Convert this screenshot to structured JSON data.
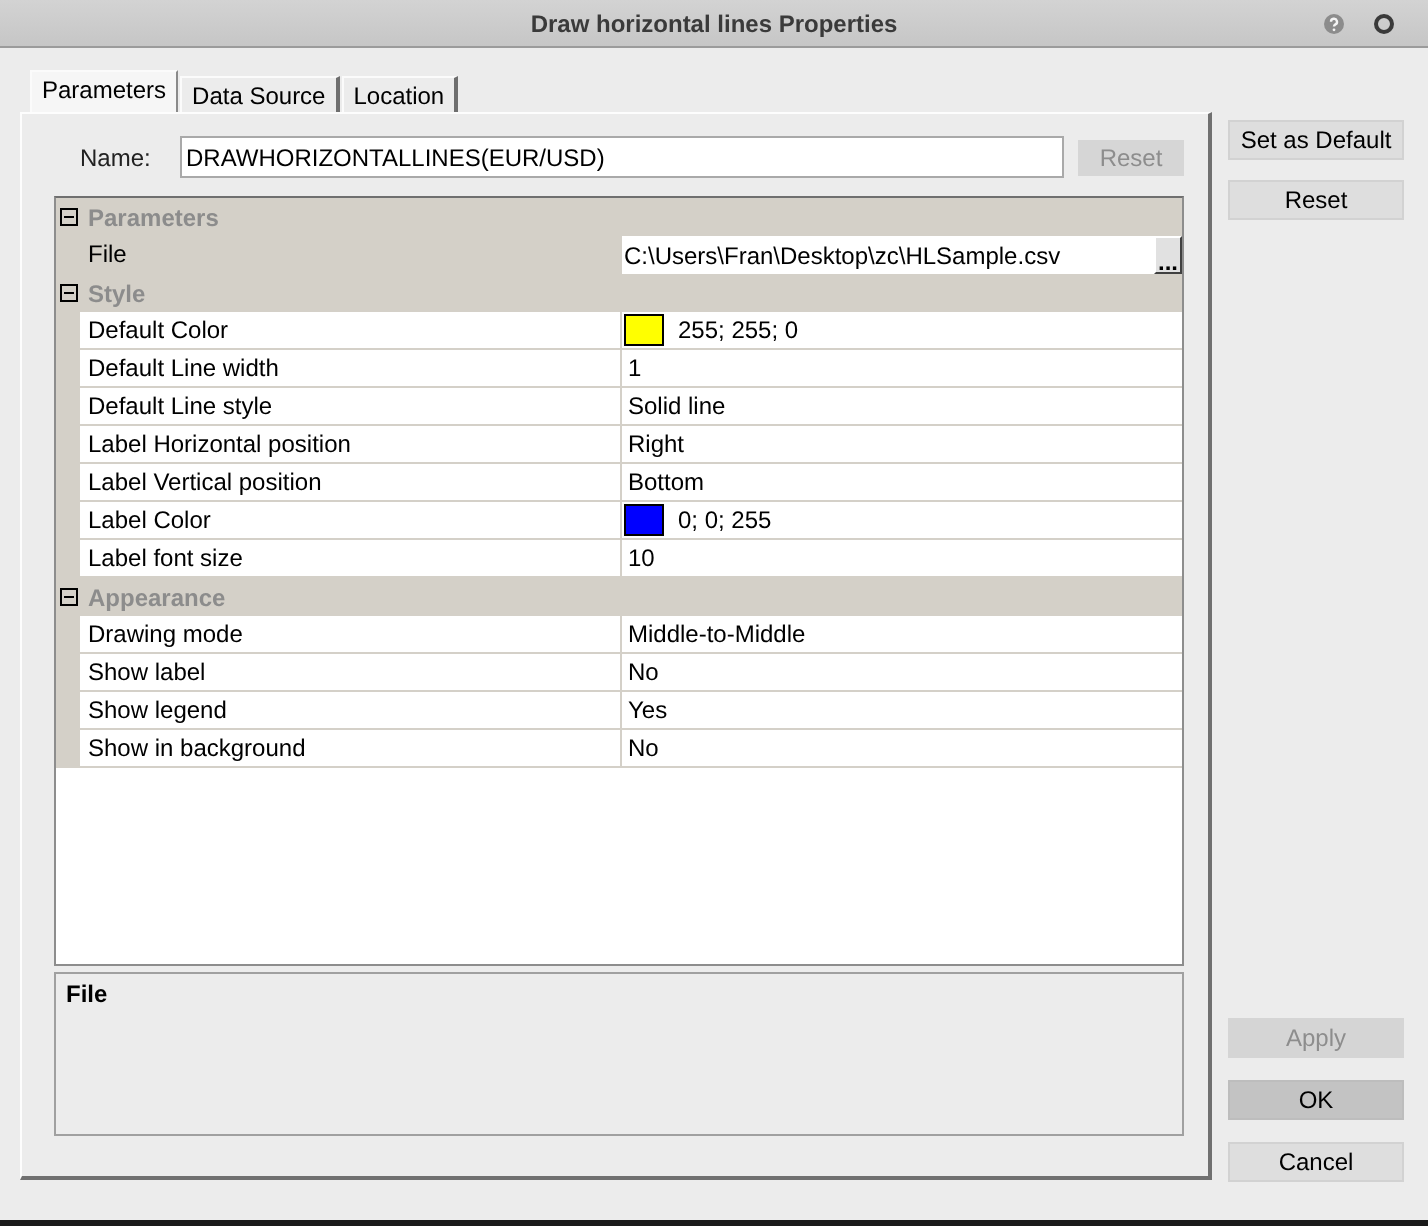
{
  "window": {
    "title": "Draw horizontal lines Properties"
  },
  "tabs": [
    {
      "label": "Parameters",
      "selected": true
    },
    {
      "label": "Data Source",
      "selected": false
    },
    {
      "label": "Location",
      "selected": false
    }
  ],
  "name_field": {
    "label": "Name:",
    "value": "DRAWHORIZONTALLINES(EUR/USD)",
    "reset_button": {
      "label": "Reset",
      "disabled": true
    }
  },
  "property_grid": {
    "categories": [
      {
        "name": "Parameters",
        "expanded": true,
        "properties": [
          {
            "name": "File",
            "kind": "file",
            "value": "C:\\Users\\Fran\\Desktop\\zc\\HLSample.csv",
            "browse_button": "...",
            "selected": true
          }
        ]
      },
      {
        "name": "Style",
        "expanded": true,
        "properties": [
          {
            "name": "Default Color",
            "kind": "color",
            "color": "#ffff00",
            "value": "255; 255; 0",
            "selected": false
          },
          {
            "name": "Default Line width",
            "kind": "text",
            "value": "1",
            "selected": false
          },
          {
            "name": "Default Line style",
            "kind": "text",
            "value": "Solid line",
            "selected": false
          },
          {
            "name": "Label Horizontal position",
            "kind": "text",
            "value": "Right",
            "selected": false
          },
          {
            "name": "Label Vertical position",
            "kind": "text",
            "value": "Bottom",
            "selected": false
          },
          {
            "name": "Label Color",
            "kind": "color",
            "color": "#0000ff",
            "value": "0; 0; 255",
            "selected": false
          },
          {
            "name": "Label font size",
            "kind": "text",
            "value": "10",
            "selected": false
          }
        ]
      },
      {
        "name": "Appearance",
        "expanded": true,
        "properties": [
          {
            "name": "Drawing mode",
            "kind": "text",
            "value": "Middle-to-Middle",
            "selected": false
          },
          {
            "name": "Show label",
            "kind": "text",
            "value": "No",
            "selected": false
          },
          {
            "name": "Show legend",
            "kind": "text",
            "value": "Yes",
            "selected": false
          },
          {
            "name": "Show in background",
            "kind": "text",
            "value": "No",
            "selected": false
          }
        ]
      }
    ]
  },
  "description": {
    "title": "File"
  },
  "side_buttons": [
    {
      "label": "Set as Default",
      "disabled": false
    },
    {
      "label": "Reset",
      "disabled": false
    }
  ],
  "dialog_buttons": [
    {
      "label": "Apply",
      "disabled": true,
      "default": false
    },
    {
      "label": "OK",
      "disabled": false,
      "default": true
    },
    {
      "label": "Cancel",
      "disabled": false,
      "default": false
    }
  ]
}
